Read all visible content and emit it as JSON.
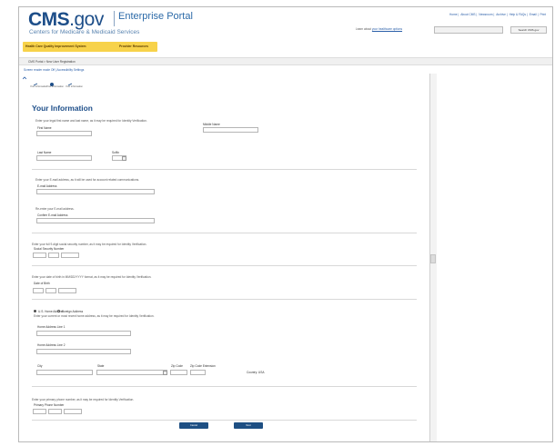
{
  "header": {
    "logo_main": "CMS",
    "logo_gov": ".gov",
    "logo_portal": "Enterprise Portal",
    "logo_subtitle": "Centers for Medicare & Medicaid Services",
    "top_links": [
      "Home",
      "About CMS",
      "Newsroom",
      "Archive",
      "Help & FAQs",
      "Email",
      "Print"
    ],
    "learn_text": "Learn about ",
    "learn_link": "your healthcare options",
    "search_placeholder": "",
    "search_button": "Search CMS.gov"
  },
  "nav": {
    "items": [
      "Health Care Quality Improvement System",
      "Provider Resources"
    ]
  },
  "breadcrumb": "CMS Portal > New User Registration",
  "reader_link": "Screen reader mode Off | Accessibility Settings",
  "stepper": {
    "steps": [
      "Your Information",
      "Your Information",
      "Your Information"
    ]
  },
  "section_title": "Your Information",
  "form": {
    "name_instr": "Enter your legal first name and last name, as it may be required for Identity Verification.",
    "first_name": "First Name",
    "middle_name": "Middle Name",
    "last_name": "Last Name",
    "suffix": "Suffix",
    "email_instr": "Enter your E-mail address, as it will be used for account related communications.",
    "email": "E-mail Address",
    "reenter_instr": "Re-enter your E-mail address.",
    "confirm_email": "Confirm E-mail Address",
    "ssn_instr": "Enter your full 9-digit social security number, as it may be required for Identity Verification.",
    "ssn": "Social Security Number",
    "dob_instr": "Enter your date of birth in MM/DD/YYYY format, as it may be required for Identity Verification.",
    "dob": "Date of Birth",
    "us_address": "U.S. Home Address",
    "foreign_address": "Foreign Address",
    "address_instr": "Enter your current or most recent home address, as it may be required for Identity Verification.",
    "address1": "Home Address Line 1",
    "address2": "Home Address Line 2",
    "city": "City",
    "state": "State",
    "zip": "Zip Code",
    "zip_ext": "Zip Code Extension",
    "country": "Country: USA",
    "phone_instr": "Enter your primary phone number, as it may be required for Identity Verification.",
    "phone": "Primary Phone Number"
  },
  "buttons": {
    "cancel": "Cancel",
    "next": "Next"
  },
  "colors": {
    "brand_blue": "#1d4e89",
    "nav_yellow": "#f7d24a",
    "button_blue": "#1e4f83"
  }
}
